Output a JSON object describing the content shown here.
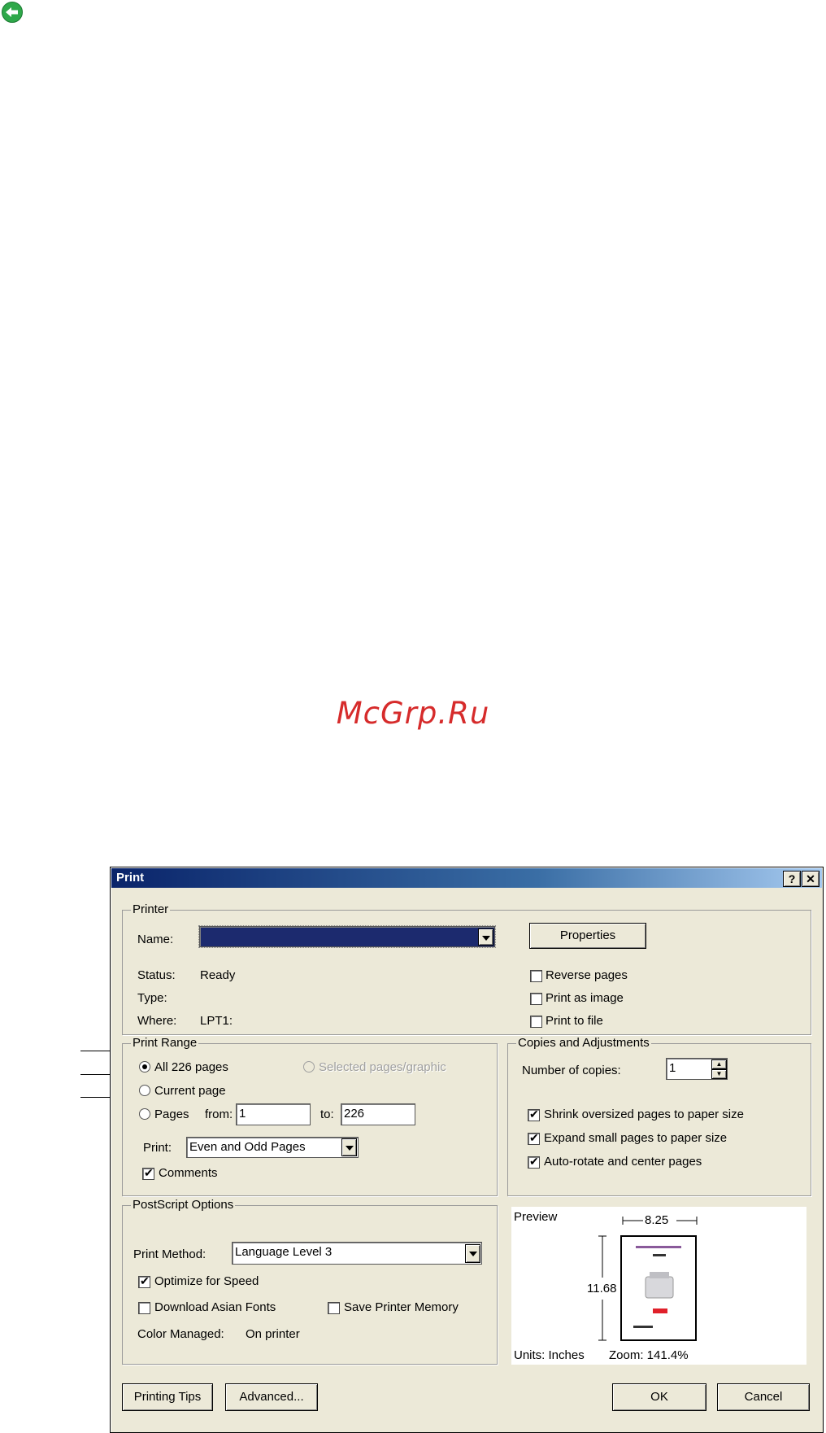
{
  "watermark": "McGrp.Ru",
  "icons": {
    "back": "back-arrow-icon"
  },
  "colors": {
    "title_bar": "#0a246a",
    "watermark": "#d62b2b",
    "dialog_bg": "#ece9d8",
    "back_icon": "#2fa84a"
  },
  "dialog": {
    "title": "Print",
    "help_button": "?",
    "close_button": "✕",
    "printer": {
      "group_label": "Printer",
      "name_label": "Name:",
      "name_value": "",
      "properties_button": "Properties",
      "status_label": "Status:",
      "status_value": "Ready",
      "type_label": "Type:",
      "type_value": "",
      "where_label": "Where:",
      "where_value": "LPT1:",
      "reverse_pages": {
        "label": "Reverse pages",
        "checked": false
      },
      "print_as_image": {
        "label": "Print as image",
        "checked": false
      },
      "print_to_file": {
        "label": "Print to file",
        "checked": false
      }
    },
    "print_range": {
      "group_label": "Print Range",
      "all_pages": {
        "label": "All 226 pages",
        "selected": true
      },
      "selected_graphic": {
        "label": "Selected pages/graphic",
        "selected": false,
        "disabled": true
      },
      "current_page": {
        "label": "Current page",
        "selected": false
      },
      "pages": {
        "label": "Pages",
        "selected": false
      },
      "from_label": "from:",
      "from_value": "1",
      "to_label": "to:",
      "to_value": "226",
      "print_label": "Print:",
      "print_value": "Even and Odd Pages",
      "comments": {
        "label": "Comments",
        "checked": true
      }
    },
    "copies": {
      "group_label": "Copies and Adjustments",
      "number_label": "Number of copies:",
      "number_value": "1",
      "shrink": {
        "label": "Shrink oversized pages to paper size",
        "checked": true
      },
      "expand": {
        "label": "Expand small pages to paper size",
        "checked": true
      },
      "autorotate": {
        "label": "Auto-rotate and center pages",
        "checked": true
      }
    },
    "postscript": {
      "group_label": "PostScript Options",
      "method_label": "Print Method:",
      "method_value": "Language Level 3",
      "optimize": {
        "label": "Optimize for Speed",
        "checked": true
      },
      "asian_fonts": {
        "label": "Download Asian Fonts",
        "checked": false
      },
      "save_memory": {
        "label": "Save Printer Memory",
        "checked": false
      },
      "color_managed_label": "Color Managed:",
      "color_managed_value": "On printer"
    },
    "preview": {
      "label": "Preview",
      "width_value": "8.25",
      "height_value": "11.68",
      "units": "Units: Inches",
      "zoom": "Zoom: 141.4%"
    },
    "buttons": {
      "printing_tips": "Printing Tips",
      "advanced": "Advanced...",
      "ok": "OK",
      "cancel": "Cancel"
    }
  }
}
